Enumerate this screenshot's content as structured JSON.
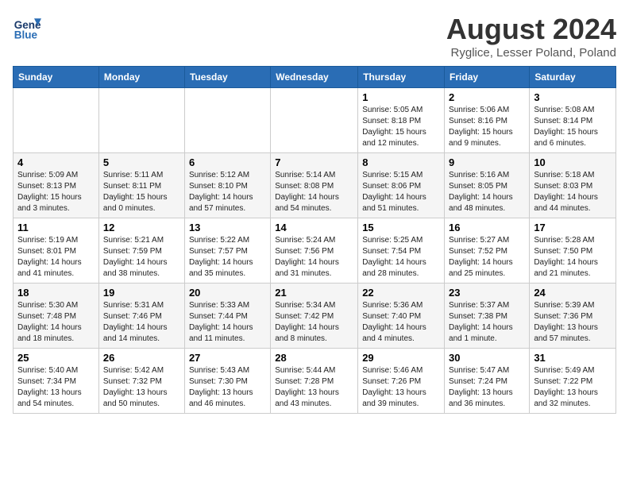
{
  "header": {
    "logo_line1": "General",
    "logo_line2": "Blue",
    "title": "August 2024",
    "location": "Ryglice, Lesser Poland, Poland"
  },
  "days_of_week": [
    "Sunday",
    "Monday",
    "Tuesday",
    "Wednesday",
    "Thursday",
    "Friday",
    "Saturday"
  ],
  "weeks": [
    [
      {
        "day": "",
        "info": ""
      },
      {
        "day": "",
        "info": ""
      },
      {
        "day": "",
        "info": ""
      },
      {
        "day": "",
        "info": ""
      },
      {
        "day": "1",
        "info": "Sunrise: 5:05 AM\nSunset: 8:18 PM\nDaylight: 15 hours\nand 12 minutes."
      },
      {
        "day": "2",
        "info": "Sunrise: 5:06 AM\nSunset: 8:16 PM\nDaylight: 15 hours\nand 9 minutes."
      },
      {
        "day": "3",
        "info": "Sunrise: 5:08 AM\nSunset: 8:14 PM\nDaylight: 15 hours\nand 6 minutes."
      }
    ],
    [
      {
        "day": "4",
        "info": "Sunrise: 5:09 AM\nSunset: 8:13 PM\nDaylight: 15 hours\nand 3 minutes."
      },
      {
        "day": "5",
        "info": "Sunrise: 5:11 AM\nSunset: 8:11 PM\nDaylight: 15 hours\nand 0 minutes."
      },
      {
        "day": "6",
        "info": "Sunrise: 5:12 AM\nSunset: 8:10 PM\nDaylight: 14 hours\nand 57 minutes."
      },
      {
        "day": "7",
        "info": "Sunrise: 5:14 AM\nSunset: 8:08 PM\nDaylight: 14 hours\nand 54 minutes."
      },
      {
        "day": "8",
        "info": "Sunrise: 5:15 AM\nSunset: 8:06 PM\nDaylight: 14 hours\nand 51 minutes."
      },
      {
        "day": "9",
        "info": "Sunrise: 5:16 AM\nSunset: 8:05 PM\nDaylight: 14 hours\nand 48 minutes."
      },
      {
        "day": "10",
        "info": "Sunrise: 5:18 AM\nSunset: 8:03 PM\nDaylight: 14 hours\nand 44 minutes."
      }
    ],
    [
      {
        "day": "11",
        "info": "Sunrise: 5:19 AM\nSunset: 8:01 PM\nDaylight: 14 hours\nand 41 minutes."
      },
      {
        "day": "12",
        "info": "Sunrise: 5:21 AM\nSunset: 7:59 PM\nDaylight: 14 hours\nand 38 minutes."
      },
      {
        "day": "13",
        "info": "Sunrise: 5:22 AM\nSunset: 7:57 PM\nDaylight: 14 hours\nand 35 minutes."
      },
      {
        "day": "14",
        "info": "Sunrise: 5:24 AM\nSunset: 7:56 PM\nDaylight: 14 hours\nand 31 minutes."
      },
      {
        "day": "15",
        "info": "Sunrise: 5:25 AM\nSunset: 7:54 PM\nDaylight: 14 hours\nand 28 minutes."
      },
      {
        "day": "16",
        "info": "Sunrise: 5:27 AM\nSunset: 7:52 PM\nDaylight: 14 hours\nand 25 minutes."
      },
      {
        "day": "17",
        "info": "Sunrise: 5:28 AM\nSunset: 7:50 PM\nDaylight: 14 hours\nand 21 minutes."
      }
    ],
    [
      {
        "day": "18",
        "info": "Sunrise: 5:30 AM\nSunset: 7:48 PM\nDaylight: 14 hours\nand 18 minutes."
      },
      {
        "day": "19",
        "info": "Sunrise: 5:31 AM\nSunset: 7:46 PM\nDaylight: 14 hours\nand 14 minutes."
      },
      {
        "day": "20",
        "info": "Sunrise: 5:33 AM\nSunset: 7:44 PM\nDaylight: 14 hours\nand 11 minutes."
      },
      {
        "day": "21",
        "info": "Sunrise: 5:34 AM\nSunset: 7:42 PM\nDaylight: 14 hours\nand 8 minutes."
      },
      {
        "day": "22",
        "info": "Sunrise: 5:36 AM\nSunset: 7:40 PM\nDaylight: 14 hours\nand 4 minutes."
      },
      {
        "day": "23",
        "info": "Sunrise: 5:37 AM\nSunset: 7:38 PM\nDaylight: 14 hours\nand 1 minute."
      },
      {
        "day": "24",
        "info": "Sunrise: 5:39 AM\nSunset: 7:36 PM\nDaylight: 13 hours\nand 57 minutes."
      }
    ],
    [
      {
        "day": "25",
        "info": "Sunrise: 5:40 AM\nSunset: 7:34 PM\nDaylight: 13 hours\nand 54 minutes."
      },
      {
        "day": "26",
        "info": "Sunrise: 5:42 AM\nSunset: 7:32 PM\nDaylight: 13 hours\nand 50 minutes."
      },
      {
        "day": "27",
        "info": "Sunrise: 5:43 AM\nSunset: 7:30 PM\nDaylight: 13 hours\nand 46 minutes."
      },
      {
        "day": "28",
        "info": "Sunrise: 5:44 AM\nSunset: 7:28 PM\nDaylight: 13 hours\nand 43 minutes."
      },
      {
        "day": "29",
        "info": "Sunrise: 5:46 AM\nSunset: 7:26 PM\nDaylight: 13 hours\nand 39 minutes."
      },
      {
        "day": "30",
        "info": "Sunrise: 5:47 AM\nSunset: 7:24 PM\nDaylight: 13 hours\nand 36 minutes."
      },
      {
        "day": "31",
        "info": "Sunrise: 5:49 AM\nSunset: 7:22 PM\nDaylight: 13 hours\nand 32 minutes."
      }
    ]
  ]
}
